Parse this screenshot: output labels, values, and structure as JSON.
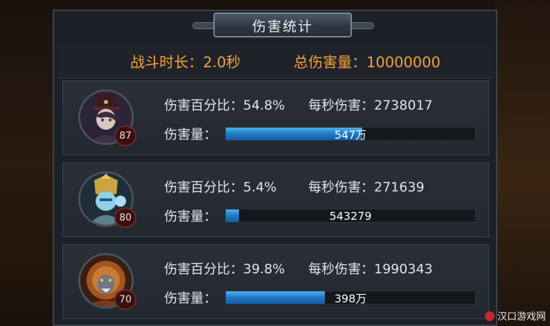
{
  "title": "伤害统计",
  "summary": {
    "duration_label": "战斗时长：2.0秒",
    "total_label": "总伤害量：10000000"
  },
  "rows": [
    {
      "level": "87",
      "percent_label": "伤害百分比：54.8%",
      "dps_label": "每秒伤害：2738017",
      "damage_label": "伤害量：",
      "damage_value": "547万",
      "bar_fraction": 0.548
    },
    {
      "level": "80",
      "percent_label": "伤害百分比：5.4%",
      "dps_label": "每秒伤害：271639",
      "damage_label": "伤害量：",
      "damage_value": "543279",
      "bar_fraction": 0.054
    },
    {
      "level": "70",
      "percent_label": "伤害百分比：39.8%",
      "dps_label": "每秒伤害：1990343",
      "damage_label": "伤害量：",
      "damage_value": "398万",
      "bar_fraction": 0.398
    }
  ],
  "watermark": "汉口游戏网",
  "colors": {
    "accent_orange": "#f0a33a",
    "bar_blue": "#1f78c4",
    "panel_bg": "#1c2027"
  }
}
